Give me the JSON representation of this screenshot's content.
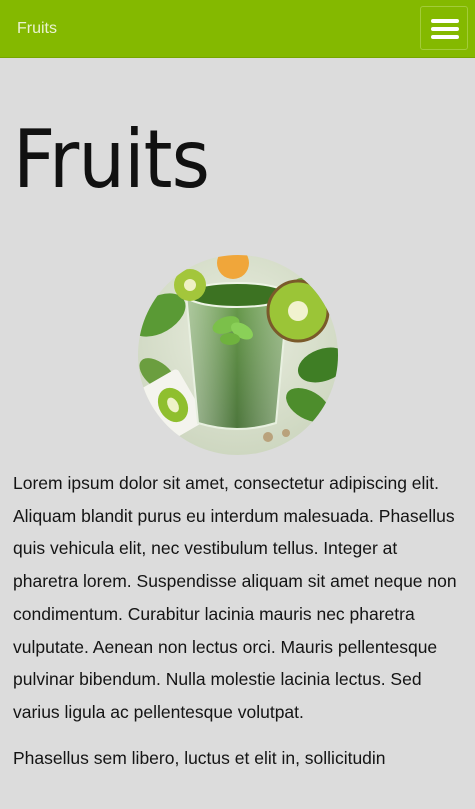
{
  "header": {
    "brand": "Fruits",
    "menu_icon": "hamburger-menu-icon",
    "bar_color": "#84b900"
  },
  "main": {
    "title": "Fruits",
    "image_subject": "green-smoothie-with-kiwi",
    "paragraphs": [
      "Lorem ipsum dolor sit amet, consectetur adipiscing elit. Aliquam blandit purus eu interdum malesuada. Phasellus quis vehicula elit, nec vestibulum tellus. Integer at pharetra lorem. Suspendisse aliquam sit amet neque non condimentum. Curabitur lacinia mauris nec pharetra vulputate. Aenean non lectus orci. Mauris pellentesque pulvinar bibendum. Nulla molestie lacinia lectus. Sed varius ligula ac pellentesque volutpat.",
      "Phasellus sem libero, luctus et elit in, sollicitudin"
    ]
  }
}
